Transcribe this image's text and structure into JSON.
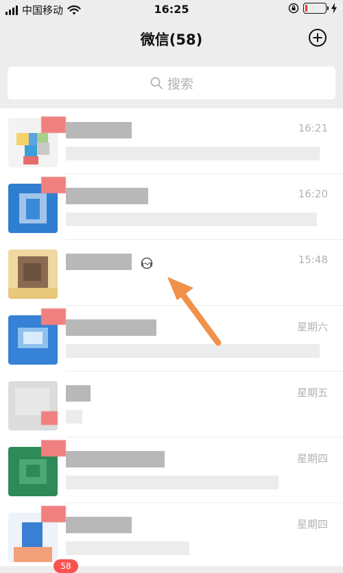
{
  "status_bar": {
    "carrier": "中国移动",
    "time": "16:25",
    "battery_level": 0.12
  },
  "header": {
    "title": "微信(58)",
    "add_icon": "plus-circle-icon"
  },
  "search": {
    "placeholder": "搜索",
    "icon": "search-icon"
  },
  "chats": [
    {
      "time": "16:21",
      "unread": true
    },
    {
      "time": "16:20",
      "unread": true
    },
    {
      "time": "15:48",
      "unread": false,
      "voice_status_icon": "headset-icon"
    },
    {
      "time": "星期六",
      "unread": true
    },
    {
      "time": "星期五",
      "unread": true
    },
    {
      "time": "星期四",
      "unread": true
    },
    {
      "time": "星期四",
      "unread": true
    }
  ],
  "tab_bar": {
    "chats_badge": "58"
  },
  "colors": {
    "accent_arrow": "#f0914a",
    "badge": "#fa5151",
    "background": "#ededed"
  }
}
